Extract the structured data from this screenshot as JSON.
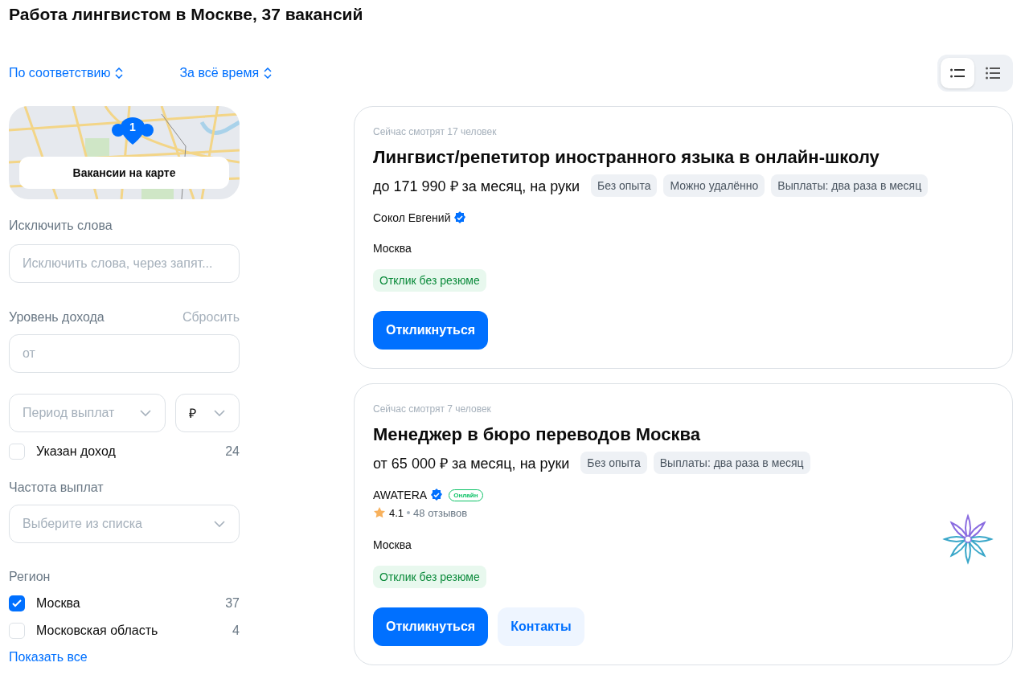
{
  "title": "Работа лингвистом в Москве, 37 вакансий",
  "sort": [
    {
      "label": "По соответствию"
    },
    {
      "label": "За всё время"
    }
  ],
  "view_toggle": [
    {
      "kind": "compact",
      "selected": true
    },
    {
      "kind": "detailed",
      "selected": false
    }
  ],
  "map": {
    "pin_count": "1",
    "button": "Вакансии на карте"
  },
  "exclude": {
    "label": "Исключить слова",
    "placeholder": "Исключить слова, через запят..."
  },
  "income": {
    "label": "Уровень дохода",
    "reset": "Сбросить",
    "from_placeholder": "от",
    "period_placeholder": "Период выплат",
    "currency": "₽",
    "checkbox": {
      "label": "Указан доход",
      "count": "24",
      "checked": false
    }
  },
  "frequency": {
    "label": "Частота выплат",
    "placeholder": "Выберите из списка"
  },
  "region": {
    "label": "Регион",
    "options": [
      {
        "label": "Москва",
        "count": "37",
        "checked": true
      },
      {
        "label": "Московская область",
        "count": "4",
        "checked": false
      }
    ],
    "show_all": "Показать все"
  },
  "vacancies": [
    {
      "viewers": "Сейчас смотрят 17 человек",
      "title": "Лингвист/репетитор иностранного языка в онлайн-школу",
      "salary": "до 171 990 ₽ за месяц, на руки",
      "tags": [
        "Без опыта",
        "Можно удалённо",
        "Выплаты: два раза в месяц"
      ],
      "employer": "Сокол Евгений",
      "verified": true,
      "city": "Москва",
      "badge": "Отклик без резюме",
      "buttons": [
        {
          "label": "Откликнуться",
          "kind": "primary"
        }
      ],
      "has_logo": false
    },
    {
      "viewers": "Сейчас смотрят 7 человек",
      "title": "Менеджер в бюро переводов Москва",
      "salary": "от 65 000 ₽ за месяц, на руки",
      "tags": [
        "Без опыта",
        "Выплаты: два раза в месяц"
      ],
      "employer": "AWATERA",
      "verified": true,
      "online": "Онлайн",
      "rating": "4.1",
      "reviews": "48 отзывов",
      "city": "Москва",
      "badge": "Отклик без резюме",
      "buttons": [
        {
          "label": "Откликнуться",
          "kind": "primary"
        },
        {
          "label": "Контакты",
          "kind": "secondary"
        }
      ],
      "has_logo": true
    }
  ]
}
